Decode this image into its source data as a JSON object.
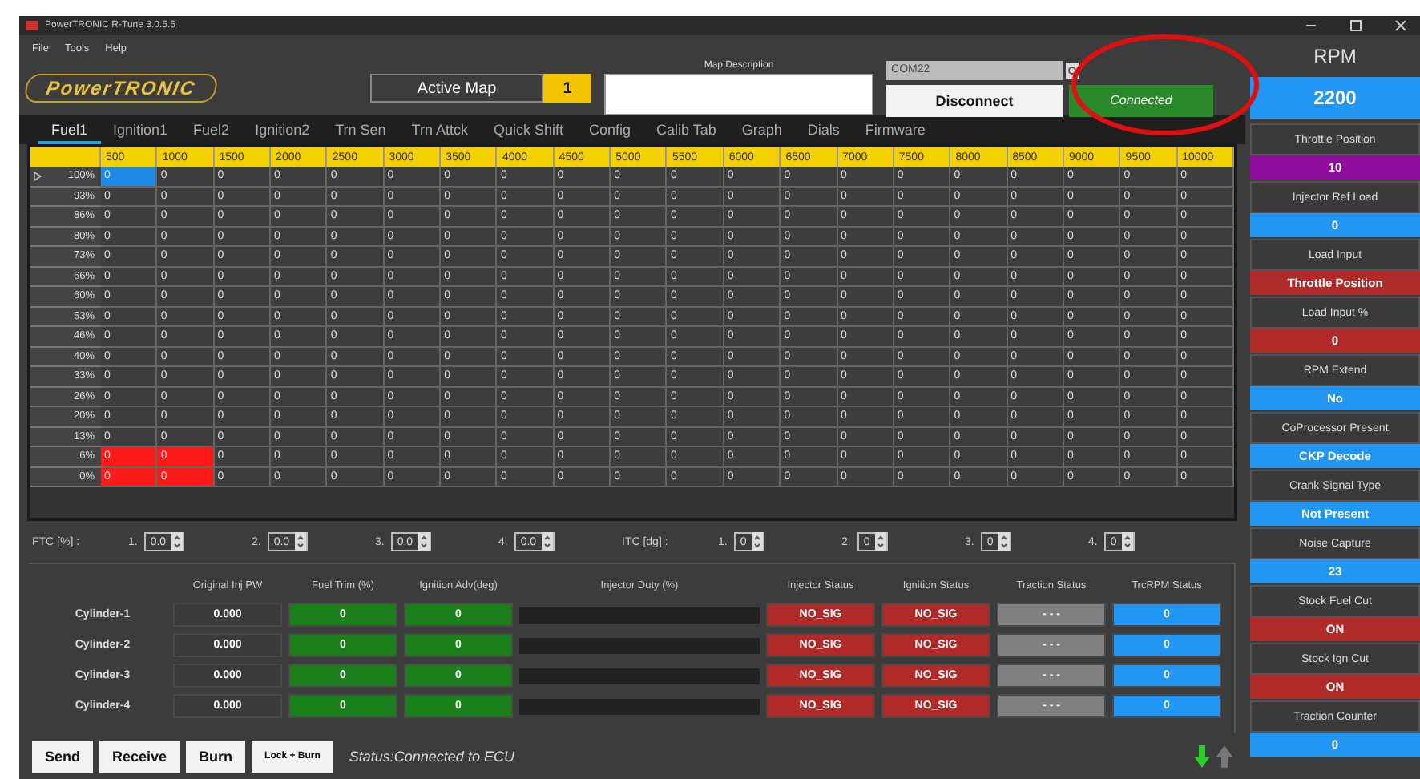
{
  "window": {
    "title": "PowerTRONIC R-Tune 3.0.5.5"
  },
  "menu": [
    "File",
    "Tools",
    "Help"
  ],
  "logo": "PowerTRONIC",
  "active_map": {
    "label": "Active Map",
    "value": "1"
  },
  "map_description": {
    "label": "Map Description"
  },
  "port": {
    "value": "COM22",
    "disabled": true
  },
  "disconnect_button": "Disconnect",
  "connection_status": "Connected",
  "tabs": [
    {
      "label": "Fuel1",
      "selected": true
    },
    {
      "label": "Ignition1",
      "selected": false
    },
    {
      "label": "Fuel2",
      "selected": false
    },
    {
      "label": "Ignition2",
      "selected": false
    },
    {
      "label": "Trn Sen",
      "selected": false
    },
    {
      "label": "Trn Attck",
      "selected": false
    },
    {
      "label": "Quick Shift",
      "selected": false
    },
    {
      "label": "Config",
      "selected": false
    },
    {
      "label": "Calib Tab",
      "selected": false
    },
    {
      "label": "Graph",
      "selected": false
    },
    {
      "label": "Dials",
      "selected": false
    },
    {
      "label": "Firmware",
      "selected": false
    }
  ],
  "table": {
    "columns": [
      "500",
      "1000",
      "1500",
      "2000",
      "2500",
      "3000",
      "3500",
      "4000",
      "4500",
      "5000",
      "5500",
      "6000",
      "6500",
      "7000",
      "7500",
      "8000",
      "8500",
      "9000",
      "9500",
      "10000"
    ],
    "rows": [
      {
        "label": "100%",
        "current": true,
        "cells": [
          {
            "value": "0",
            "kind": "cursor"
          },
          {
            "value": "0",
            "kind": "plain"
          },
          {
            "value": "0",
            "kind": "plain"
          },
          {
            "value": "0",
            "kind": "plain"
          },
          {
            "value": "0",
            "kind": "plain"
          },
          {
            "value": "0",
            "kind": "plain"
          },
          {
            "value": "0",
            "kind": "plain"
          },
          {
            "value": "0",
            "kind": "plain"
          },
          {
            "value": "0",
            "kind": "plain"
          },
          {
            "value": "0",
            "kind": "plain"
          },
          {
            "value": "0",
            "kind": "plain"
          },
          {
            "value": "0",
            "kind": "plain"
          },
          {
            "value": "0",
            "kind": "plain"
          },
          {
            "value": "0",
            "kind": "plain"
          },
          {
            "value": "0",
            "kind": "plain"
          },
          {
            "value": "0",
            "kind": "plain"
          },
          {
            "value": "0",
            "kind": "plain"
          },
          {
            "value": "0",
            "kind": "plain"
          },
          {
            "value": "0",
            "kind": "plain"
          },
          {
            "value": "0",
            "kind": "plain"
          }
        ]
      },
      {
        "label": "93%",
        "current": false,
        "cells": [
          {
            "value": "0",
            "kind": "plain"
          },
          {
            "value": "0",
            "kind": "plain"
          },
          {
            "value": "0",
            "kind": "plain"
          },
          {
            "value": "0",
            "kind": "plain"
          },
          {
            "value": "0",
            "kind": "plain"
          },
          {
            "value": "0",
            "kind": "plain"
          },
          {
            "value": "0",
            "kind": "plain"
          },
          {
            "value": "0",
            "kind": "plain"
          },
          {
            "value": "0",
            "kind": "plain"
          },
          {
            "value": "0",
            "kind": "plain"
          },
          {
            "value": "0",
            "kind": "plain"
          },
          {
            "value": "0",
            "kind": "plain"
          },
          {
            "value": "0",
            "kind": "plain"
          },
          {
            "value": "0",
            "kind": "plain"
          },
          {
            "value": "0",
            "kind": "plain"
          },
          {
            "value": "0",
            "kind": "plain"
          },
          {
            "value": "0",
            "kind": "plain"
          },
          {
            "value": "0",
            "kind": "plain"
          },
          {
            "value": "0",
            "kind": "plain"
          },
          {
            "value": "0",
            "kind": "plain"
          }
        ]
      },
      {
        "label": "86%",
        "current": false,
        "cells": [
          {
            "value": "0",
            "kind": "plain"
          },
          {
            "value": "0",
            "kind": "plain"
          },
          {
            "value": "0",
            "kind": "plain"
          },
          {
            "value": "0",
            "kind": "plain"
          },
          {
            "value": "0",
            "kind": "plain"
          },
          {
            "value": "0",
            "kind": "plain"
          },
          {
            "value": "0",
            "kind": "plain"
          },
          {
            "value": "0",
            "kind": "plain"
          },
          {
            "value": "0",
            "kind": "plain"
          },
          {
            "value": "0",
            "kind": "plain"
          },
          {
            "value": "0",
            "kind": "plain"
          },
          {
            "value": "0",
            "kind": "plain"
          },
          {
            "value": "0",
            "kind": "plain"
          },
          {
            "value": "0",
            "kind": "plain"
          },
          {
            "value": "0",
            "kind": "plain"
          },
          {
            "value": "0",
            "kind": "plain"
          },
          {
            "value": "0",
            "kind": "plain"
          },
          {
            "value": "0",
            "kind": "plain"
          },
          {
            "value": "0",
            "kind": "plain"
          },
          {
            "value": "0",
            "kind": "plain"
          }
        ]
      },
      {
        "label": "80%",
        "current": false,
        "cells": [
          {
            "value": "0",
            "kind": "plain"
          },
          {
            "value": "0",
            "kind": "plain"
          },
          {
            "value": "0",
            "kind": "plain"
          },
          {
            "value": "0",
            "kind": "plain"
          },
          {
            "value": "0",
            "kind": "plain"
          },
          {
            "value": "0",
            "kind": "plain"
          },
          {
            "value": "0",
            "kind": "plain"
          },
          {
            "value": "0",
            "kind": "plain"
          },
          {
            "value": "0",
            "kind": "plain"
          },
          {
            "value": "0",
            "kind": "plain"
          },
          {
            "value": "0",
            "kind": "plain"
          },
          {
            "value": "0",
            "kind": "plain"
          },
          {
            "value": "0",
            "kind": "plain"
          },
          {
            "value": "0",
            "kind": "plain"
          },
          {
            "value": "0",
            "kind": "plain"
          },
          {
            "value": "0",
            "kind": "plain"
          },
          {
            "value": "0",
            "kind": "plain"
          },
          {
            "value": "0",
            "kind": "plain"
          },
          {
            "value": "0",
            "kind": "plain"
          },
          {
            "value": "0",
            "kind": "plain"
          }
        ]
      },
      {
        "label": "73%",
        "current": false,
        "cells": [
          {
            "value": "0",
            "kind": "plain"
          },
          {
            "value": "0",
            "kind": "plain"
          },
          {
            "value": "0",
            "kind": "plain"
          },
          {
            "value": "0",
            "kind": "plain"
          },
          {
            "value": "0",
            "kind": "plain"
          },
          {
            "value": "0",
            "kind": "plain"
          },
          {
            "value": "0",
            "kind": "plain"
          },
          {
            "value": "0",
            "kind": "plain"
          },
          {
            "value": "0",
            "kind": "plain"
          },
          {
            "value": "0",
            "kind": "plain"
          },
          {
            "value": "0",
            "kind": "plain"
          },
          {
            "value": "0",
            "kind": "plain"
          },
          {
            "value": "0",
            "kind": "plain"
          },
          {
            "value": "0",
            "kind": "plain"
          },
          {
            "value": "0",
            "kind": "plain"
          },
          {
            "value": "0",
            "kind": "plain"
          },
          {
            "value": "0",
            "kind": "plain"
          },
          {
            "value": "0",
            "kind": "plain"
          },
          {
            "value": "0",
            "kind": "plain"
          },
          {
            "value": "0",
            "kind": "plain"
          }
        ]
      },
      {
        "label": "66%",
        "current": false,
        "cells": [
          {
            "value": "0",
            "kind": "plain"
          },
          {
            "value": "0",
            "kind": "plain"
          },
          {
            "value": "0",
            "kind": "plain"
          },
          {
            "value": "0",
            "kind": "plain"
          },
          {
            "value": "0",
            "kind": "plain"
          },
          {
            "value": "0",
            "kind": "plain"
          },
          {
            "value": "0",
            "kind": "plain"
          },
          {
            "value": "0",
            "kind": "plain"
          },
          {
            "value": "0",
            "kind": "plain"
          },
          {
            "value": "0",
            "kind": "plain"
          },
          {
            "value": "0",
            "kind": "plain"
          },
          {
            "value": "0",
            "kind": "plain"
          },
          {
            "value": "0",
            "kind": "plain"
          },
          {
            "value": "0",
            "kind": "plain"
          },
          {
            "value": "0",
            "kind": "plain"
          },
          {
            "value": "0",
            "kind": "plain"
          },
          {
            "value": "0",
            "kind": "plain"
          },
          {
            "value": "0",
            "kind": "plain"
          },
          {
            "value": "0",
            "kind": "plain"
          },
          {
            "value": "0",
            "kind": "plain"
          }
        ]
      },
      {
        "label": "60%",
        "current": false,
        "cells": [
          {
            "value": "0",
            "kind": "plain"
          },
          {
            "value": "0",
            "kind": "plain"
          },
          {
            "value": "0",
            "kind": "plain"
          },
          {
            "value": "0",
            "kind": "plain"
          },
          {
            "value": "0",
            "kind": "plain"
          },
          {
            "value": "0",
            "kind": "plain"
          },
          {
            "value": "0",
            "kind": "plain"
          },
          {
            "value": "0",
            "kind": "plain"
          },
          {
            "value": "0",
            "kind": "plain"
          },
          {
            "value": "0",
            "kind": "plain"
          },
          {
            "value": "0",
            "kind": "plain"
          },
          {
            "value": "0",
            "kind": "plain"
          },
          {
            "value": "0",
            "kind": "plain"
          },
          {
            "value": "0",
            "kind": "plain"
          },
          {
            "value": "0",
            "kind": "plain"
          },
          {
            "value": "0",
            "kind": "plain"
          },
          {
            "value": "0",
            "kind": "plain"
          },
          {
            "value": "0",
            "kind": "plain"
          },
          {
            "value": "0",
            "kind": "plain"
          },
          {
            "value": "0",
            "kind": "plain"
          }
        ]
      },
      {
        "label": "53%",
        "current": false,
        "cells": [
          {
            "value": "0",
            "kind": "plain"
          },
          {
            "value": "0",
            "kind": "plain"
          },
          {
            "value": "0",
            "kind": "plain"
          },
          {
            "value": "0",
            "kind": "plain"
          },
          {
            "value": "0",
            "kind": "plain"
          },
          {
            "value": "0",
            "kind": "plain"
          },
          {
            "value": "0",
            "kind": "plain"
          },
          {
            "value": "0",
            "kind": "plain"
          },
          {
            "value": "0",
            "kind": "plain"
          },
          {
            "value": "0",
            "kind": "plain"
          },
          {
            "value": "0",
            "kind": "plain"
          },
          {
            "value": "0",
            "kind": "plain"
          },
          {
            "value": "0",
            "kind": "plain"
          },
          {
            "value": "0",
            "kind": "plain"
          },
          {
            "value": "0",
            "kind": "plain"
          },
          {
            "value": "0",
            "kind": "plain"
          },
          {
            "value": "0",
            "kind": "plain"
          },
          {
            "value": "0",
            "kind": "plain"
          },
          {
            "value": "0",
            "kind": "plain"
          },
          {
            "value": "0",
            "kind": "plain"
          }
        ]
      },
      {
        "label": "46%",
        "current": false,
        "cells": [
          {
            "value": "0",
            "kind": "plain"
          },
          {
            "value": "0",
            "kind": "plain"
          },
          {
            "value": "0",
            "kind": "plain"
          },
          {
            "value": "0",
            "kind": "plain"
          },
          {
            "value": "0",
            "kind": "plain"
          },
          {
            "value": "0",
            "kind": "plain"
          },
          {
            "value": "0",
            "kind": "plain"
          },
          {
            "value": "0",
            "kind": "plain"
          },
          {
            "value": "0",
            "kind": "plain"
          },
          {
            "value": "0",
            "kind": "plain"
          },
          {
            "value": "0",
            "kind": "plain"
          },
          {
            "value": "0",
            "kind": "plain"
          },
          {
            "value": "0",
            "kind": "plain"
          },
          {
            "value": "0",
            "kind": "plain"
          },
          {
            "value": "0",
            "kind": "plain"
          },
          {
            "value": "0",
            "kind": "plain"
          },
          {
            "value": "0",
            "kind": "plain"
          },
          {
            "value": "0",
            "kind": "plain"
          },
          {
            "value": "0",
            "kind": "plain"
          },
          {
            "value": "0",
            "kind": "plain"
          }
        ]
      },
      {
        "label": "40%",
        "current": false,
        "cells": [
          {
            "value": "0",
            "kind": "plain"
          },
          {
            "value": "0",
            "kind": "plain"
          },
          {
            "value": "0",
            "kind": "plain"
          },
          {
            "value": "0",
            "kind": "plain"
          },
          {
            "value": "0",
            "kind": "plain"
          },
          {
            "value": "0",
            "kind": "plain"
          },
          {
            "value": "0",
            "kind": "plain"
          },
          {
            "value": "0",
            "kind": "plain"
          },
          {
            "value": "0",
            "kind": "plain"
          },
          {
            "value": "0",
            "kind": "plain"
          },
          {
            "value": "0",
            "kind": "plain"
          },
          {
            "value": "0",
            "kind": "plain"
          },
          {
            "value": "0",
            "kind": "plain"
          },
          {
            "value": "0",
            "kind": "plain"
          },
          {
            "value": "0",
            "kind": "plain"
          },
          {
            "value": "0",
            "kind": "plain"
          },
          {
            "value": "0",
            "kind": "plain"
          },
          {
            "value": "0",
            "kind": "plain"
          },
          {
            "value": "0",
            "kind": "plain"
          },
          {
            "value": "0",
            "kind": "plain"
          }
        ]
      },
      {
        "label": "33%",
        "current": false,
        "cells": [
          {
            "value": "0",
            "kind": "plain"
          },
          {
            "value": "0",
            "kind": "plain"
          },
          {
            "value": "0",
            "kind": "plain"
          },
          {
            "value": "0",
            "kind": "plain"
          },
          {
            "value": "0",
            "kind": "plain"
          },
          {
            "value": "0",
            "kind": "plain"
          },
          {
            "value": "0",
            "kind": "plain"
          },
          {
            "value": "0",
            "kind": "plain"
          },
          {
            "value": "0",
            "kind": "plain"
          },
          {
            "value": "0",
            "kind": "plain"
          },
          {
            "value": "0",
            "kind": "plain"
          },
          {
            "value": "0",
            "kind": "plain"
          },
          {
            "value": "0",
            "kind": "plain"
          },
          {
            "value": "0",
            "kind": "plain"
          },
          {
            "value": "0",
            "kind": "plain"
          },
          {
            "value": "0",
            "kind": "plain"
          },
          {
            "value": "0",
            "kind": "plain"
          },
          {
            "value": "0",
            "kind": "plain"
          },
          {
            "value": "0",
            "kind": "plain"
          },
          {
            "value": "0",
            "kind": "plain"
          }
        ]
      },
      {
        "label": "26%",
        "current": false,
        "cells": [
          {
            "value": "0",
            "kind": "plain"
          },
          {
            "value": "0",
            "kind": "plain"
          },
          {
            "value": "0",
            "kind": "plain"
          },
          {
            "value": "0",
            "kind": "plain"
          },
          {
            "value": "0",
            "kind": "plain"
          },
          {
            "value": "0",
            "kind": "plain"
          },
          {
            "value": "0",
            "kind": "plain"
          },
          {
            "value": "0",
            "kind": "plain"
          },
          {
            "value": "0",
            "kind": "plain"
          },
          {
            "value": "0",
            "kind": "plain"
          },
          {
            "value": "0",
            "kind": "plain"
          },
          {
            "value": "0",
            "kind": "plain"
          },
          {
            "value": "0",
            "kind": "plain"
          },
          {
            "value": "0",
            "kind": "plain"
          },
          {
            "value": "0",
            "kind": "plain"
          },
          {
            "value": "0",
            "kind": "plain"
          },
          {
            "value": "0",
            "kind": "plain"
          },
          {
            "value": "0",
            "kind": "plain"
          },
          {
            "value": "0",
            "kind": "plain"
          },
          {
            "value": "0",
            "kind": "plain"
          }
        ]
      },
      {
        "label": "20%",
        "current": false,
        "cells": [
          {
            "value": "0",
            "kind": "plain"
          },
          {
            "value": "0",
            "kind": "plain"
          },
          {
            "value": "0",
            "kind": "plain"
          },
          {
            "value": "0",
            "kind": "plain"
          },
          {
            "value": "0",
            "kind": "plain"
          },
          {
            "value": "0",
            "kind": "plain"
          },
          {
            "value": "0",
            "kind": "plain"
          },
          {
            "value": "0",
            "kind": "plain"
          },
          {
            "value": "0",
            "kind": "plain"
          },
          {
            "value": "0",
            "kind": "plain"
          },
          {
            "value": "0",
            "kind": "plain"
          },
          {
            "value": "0",
            "kind": "plain"
          },
          {
            "value": "0",
            "kind": "plain"
          },
          {
            "value": "0",
            "kind": "plain"
          },
          {
            "value": "0",
            "kind": "plain"
          },
          {
            "value": "0",
            "kind": "plain"
          },
          {
            "value": "0",
            "kind": "plain"
          },
          {
            "value": "0",
            "kind": "plain"
          },
          {
            "value": "0",
            "kind": "plain"
          },
          {
            "value": "0",
            "kind": "plain"
          }
        ]
      },
      {
        "label": "13%",
        "current": false,
        "cells": [
          {
            "value": "0",
            "kind": "plain"
          },
          {
            "value": "0",
            "kind": "plain"
          },
          {
            "value": "0",
            "kind": "plain"
          },
          {
            "value": "0",
            "kind": "plain"
          },
          {
            "value": "0",
            "kind": "plain"
          },
          {
            "value": "0",
            "kind": "plain"
          },
          {
            "value": "0",
            "kind": "plain"
          },
          {
            "value": "0",
            "kind": "plain"
          },
          {
            "value": "0",
            "kind": "plain"
          },
          {
            "value": "0",
            "kind": "plain"
          },
          {
            "value": "0",
            "kind": "plain"
          },
          {
            "value": "0",
            "kind": "plain"
          },
          {
            "value": "0",
            "kind": "plain"
          },
          {
            "value": "0",
            "kind": "plain"
          },
          {
            "value": "0",
            "kind": "plain"
          },
          {
            "value": "0",
            "kind": "plain"
          },
          {
            "value": "0",
            "kind": "plain"
          },
          {
            "value": "0",
            "kind": "plain"
          },
          {
            "value": "0",
            "kind": "plain"
          },
          {
            "value": "0",
            "kind": "plain"
          }
        ]
      },
      {
        "label": "6%",
        "current": false,
        "cells": [
          {
            "value": "0",
            "kind": "alarm"
          },
          {
            "value": "0",
            "kind": "alarm"
          },
          {
            "value": "0",
            "kind": "plain"
          },
          {
            "value": "0",
            "kind": "plain"
          },
          {
            "value": "0",
            "kind": "plain"
          },
          {
            "value": "0",
            "kind": "plain"
          },
          {
            "value": "0",
            "kind": "plain"
          },
          {
            "value": "0",
            "kind": "plain"
          },
          {
            "value": "0",
            "kind": "plain"
          },
          {
            "value": "0",
            "kind": "plain"
          },
          {
            "value": "0",
            "kind": "plain"
          },
          {
            "value": "0",
            "kind": "plain"
          },
          {
            "value": "0",
            "kind": "plain"
          },
          {
            "value": "0",
            "kind": "plain"
          },
          {
            "value": "0",
            "kind": "plain"
          },
          {
            "value": "0",
            "kind": "plain"
          },
          {
            "value": "0",
            "kind": "plain"
          },
          {
            "value": "0",
            "kind": "plain"
          },
          {
            "value": "0",
            "kind": "plain"
          },
          {
            "value": "0",
            "kind": "plain"
          }
        ]
      },
      {
        "label": "0%",
        "current": false,
        "cells": [
          {
            "value": "0",
            "kind": "alarm"
          },
          {
            "value": "0",
            "kind": "alarm"
          },
          {
            "value": "0",
            "kind": "plain"
          },
          {
            "value": "0",
            "kind": "plain"
          },
          {
            "value": "0",
            "kind": "plain"
          },
          {
            "value": "0",
            "kind": "plain"
          },
          {
            "value": "0",
            "kind": "plain"
          },
          {
            "value": "0",
            "kind": "plain"
          },
          {
            "value": "0",
            "kind": "plain"
          },
          {
            "value": "0",
            "kind": "plain"
          },
          {
            "value": "0",
            "kind": "plain"
          },
          {
            "value": "0",
            "kind": "plain"
          },
          {
            "value": "0",
            "kind": "plain"
          },
          {
            "value": "0",
            "kind": "plain"
          },
          {
            "value": "0",
            "kind": "plain"
          },
          {
            "value": "0",
            "kind": "plain"
          },
          {
            "value": "0",
            "kind": "plain"
          },
          {
            "value": "0",
            "kind": "plain"
          },
          {
            "value": "0",
            "kind": "plain"
          },
          {
            "value": "0",
            "kind": "plain"
          }
        ]
      }
    ]
  },
  "ftc": {
    "label": "FTC [%] :",
    "fields": [
      {
        "index": "1.",
        "value": "0.0"
      },
      {
        "index": "2.",
        "value": "0.0"
      },
      {
        "index": "3.",
        "value": "0.0"
      },
      {
        "index": "4.",
        "value": "0.0"
      }
    ]
  },
  "itc": {
    "label": "ITC [dg] :",
    "fields": [
      {
        "index": "1.",
        "value": "0"
      },
      {
        "index": "2.",
        "value": "0"
      },
      {
        "index": "3.",
        "value": "0"
      },
      {
        "index": "4.",
        "value": "0"
      }
    ]
  },
  "cylinders": {
    "columns": [
      "Original Inj PW",
      "Fuel Trim (%)",
      "Ignition Adv(deg)",
      "Injector Duty (%)",
      "Injector Status",
      "Ignition Status",
      "Traction Status",
      "TrcRPM Status"
    ],
    "rows": [
      {
        "name": "Cylinder-1",
        "inj_pw": "0.000",
        "fuel_trim": "0",
        "ign_adv": "0",
        "duty": {
          "level": 0
        },
        "injector_status": "NO_SIG",
        "ignition_status": "NO_SIG",
        "traction_status": "- - -",
        "trc_rpm": "0"
      },
      {
        "name": "Cylinder-2",
        "inj_pw": "0.000",
        "fuel_trim": "0",
        "ign_adv": "0",
        "duty": {
          "level": 0
        },
        "injector_status": "NO_SIG",
        "ignition_status": "NO_SIG",
        "traction_status": "- - -",
        "trc_rpm": "0"
      },
      {
        "name": "Cylinder-3",
        "inj_pw": "0.000",
        "fuel_trim": "0",
        "ign_adv": "0",
        "duty": {
          "level": 0
        },
        "injector_status": "NO_SIG",
        "ignition_status": "NO_SIG",
        "traction_status": "- - -",
        "trc_rpm": "0"
      },
      {
        "name": "Cylinder-4",
        "inj_pw": "0.000",
        "fuel_trim": "0",
        "ign_adv": "0",
        "duty": {
          "level": 0
        },
        "injector_status": "NO_SIG",
        "ignition_status": "NO_SIG",
        "traction_status": "- - -",
        "trc_rpm": "0"
      }
    ]
  },
  "buttons": [
    "Send",
    "Receive",
    "Burn",
    "Lock + Burn"
  ],
  "status": "Status:Connected to ECU",
  "rpm": {
    "label": "RPM",
    "value": "2200"
  },
  "gauges": [
    {
      "label": "Throttle Position",
      "value": "10",
      "color": "#8e0f9c"
    },
    {
      "label": "Injector Ref Load",
      "value": "0",
      "color": "#2196f3"
    },
    {
      "label": "Load Input",
      "value": "Throttle Position",
      "color": "#b02a2a"
    },
    {
      "label": "Load Input %",
      "value": "0",
      "color": "#b02a2a"
    },
    {
      "label": "RPM Extend",
      "value": "No",
      "color": "#2196f3"
    },
    {
      "label": "CoProcessor Present",
      "value": "CKP Decode",
      "color": "#2196f3"
    },
    {
      "label": "Crank Signal Type",
      "value": "Not Present",
      "color": "#2196f3"
    },
    {
      "label": "Noise Capture",
      "value": "23",
      "color": "#2196f3"
    },
    {
      "label": "Stock Fuel Cut",
      "value": "ON",
      "color": "#b02a2a"
    },
    {
      "label": "Stock Ign Cut",
      "value": "ON",
      "color": "#b02a2a"
    },
    {
      "label": "Traction Counter",
      "value": "0",
      "color": "#2196f3"
    }
  ]
}
